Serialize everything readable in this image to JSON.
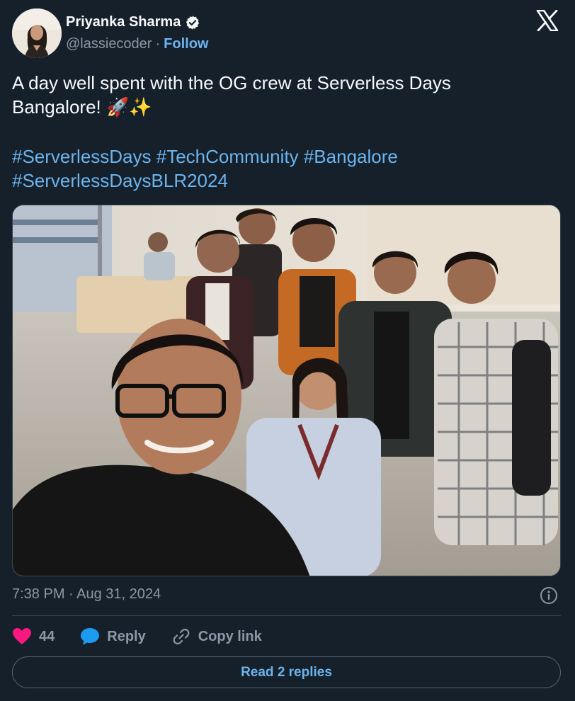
{
  "author": {
    "display_name": "Priyanka Sharma",
    "handle": "@lassiecoder",
    "separator": "·",
    "follow_label": "Follow",
    "verified": true
  },
  "tweet": {
    "line1": "A day well spent with the OG crew at Serverless Days",
    "line2": "Bangalore!  🚀✨",
    "hashtags_line1": [
      "#ServerlessDays",
      "#TechCommunity",
      "#Bangalore"
    ],
    "hashtags_line2": [
      "#ServerlessDaysBLR2024"
    ]
  },
  "timestamp": "7:38 PM · Aug 31, 2024",
  "actions": {
    "like_count": "44",
    "reply_label": "Reply",
    "copy_link_label": "Copy link"
  },
  "read_replies_label": "Read 2 replies",
  "colors": {
    "background": "#15202b",
    "link": "#6cb4ee",
    "muted": "#8b98a5",
    "like": "#f91880",
    "reply": "#1d9bf0",
    "border": "#38444d"
  },
  "icons": {
    "brand": "x-logo-icon",
    "verified": "verified-badge-icon",
    "info": "info-icon",
    "like": "heart-icon",
    "reply": "speech-bubble-icon",
    "copy": "link-icon"
  }
}
